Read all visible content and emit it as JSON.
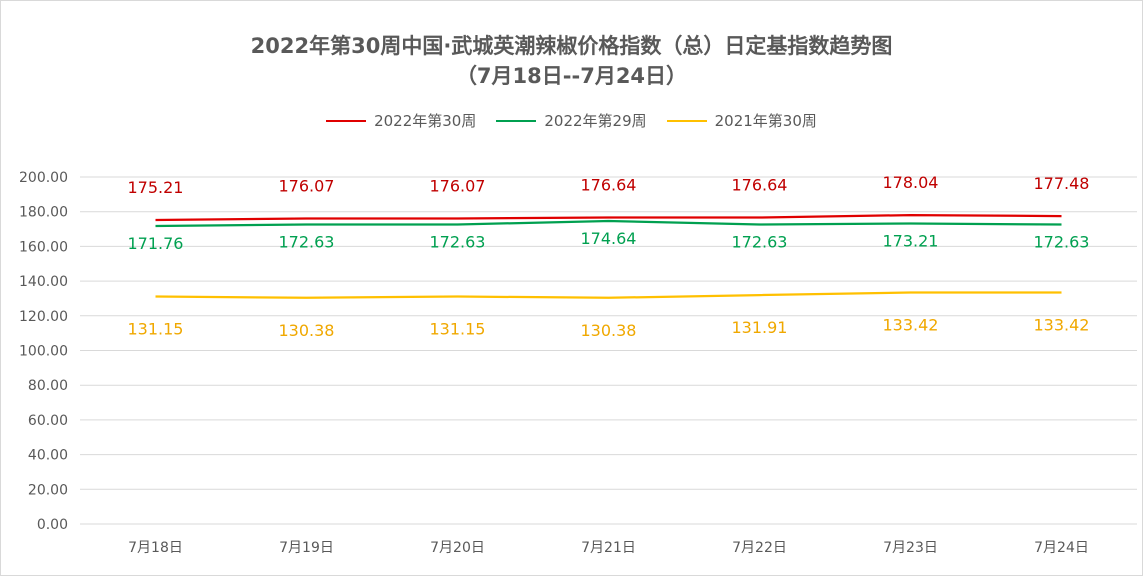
{
  "chart_data": {
    "type": "line",
    "title_line1": "2022年第30周中国·武城英潮辣椒价格指数（总）日定基指数趋势图",
    "title_line2": "（7月18日--7月24日）",
    "categories": [
      "7月18日",
      "7月19日",
      "7月20日",
      "7月21日",
      "7月22日",
      "7月23日",
      "7月24日"
    ],
    "ylim": [
      0,
      200
    ],
    "yticks": [
      "0.00",
      "20.00",
      "40.00",
      "60.00",
      "80.00",
      "100.00",
      "120.00",
      "140.00",
      "160.00",
      "180.00",
      "200.00"
    ],
    "grid": true,
    "legend_position": "top",
    "series": [
      {
        "name": "2022年第30周",
        "color": "#e00000",
        "label_color": "#c00000",
        "label_position": "above",
        "values": [
          175.21,
          176.07,
          176.07,
          176.64,
          176.64,
          178.04,
          177.48
        ],
        "labels": [
          "175.21",
          "176.07",
          "176.07",
          "176.64",
          "176.64",
          "178.04",
          "177.48"
        ]
      },
      {
        "name": "2022年第29周",
        "color": "#00a050",
        "label_color": "#00a050",
        "label_position": "below",
        "values": [
          171.76,
          172.63,
          172.63,
          174.64,
          172.63,
          173.21,
          172.63
        ],
        "labels": [
          "171.76",
          "172.63",
          "172.63",
          "174.64",
          "172.63",
          "173.21",
          "172.63"
        ]
      },
      {
        "name": "2021年第30周",
        "color": "#ffc000",
        "label_color": "#f0a800",
        "label_position": "below",
        "values": [
          131.15,
          130.38,
          131.15,
          130.38,
          131.91,
          133.42,
          133.42
        ],
        "labels": [
          "131.15",
          "130.38",
          "131.15",
          "130.38",
          "131.91",
          "133.42",
          "133.42"
        ]
      }
    ]
  }
}
